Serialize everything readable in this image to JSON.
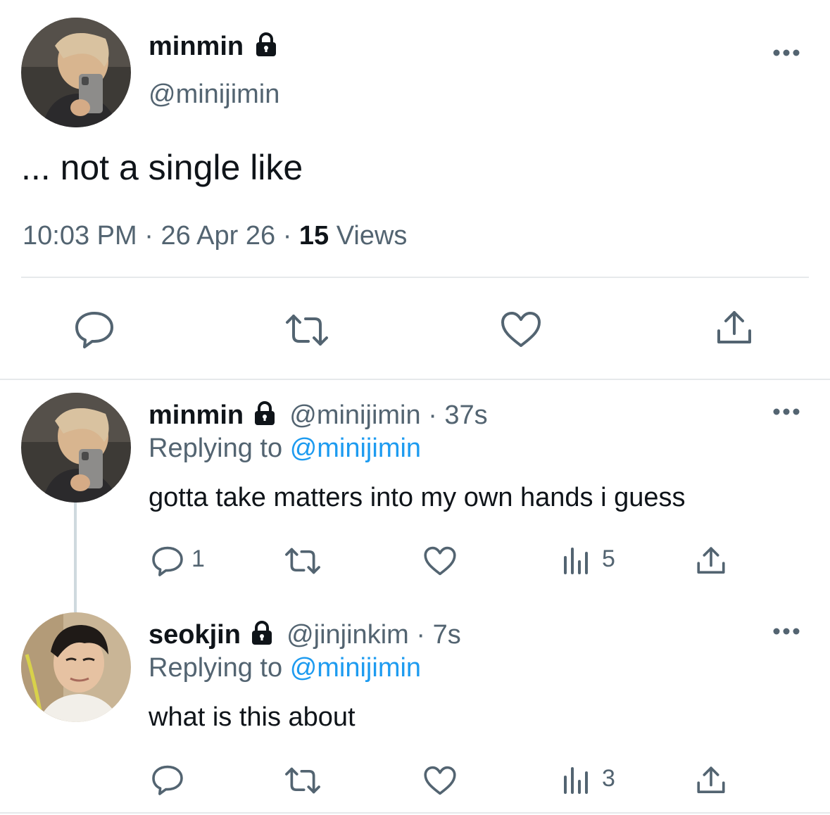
{
  "main_tweet": {
    "display_name": "minmin",
    "handle": "@minijimin",
    "text": "... not a single like",
    "time": "10:03 PM",
    "date": "26 Apr 26",
    "views_count": "15",
    "views_label": "Views",
    "sep": "·"
  },
  "replies": [
    {
      "display_name": "minmin",
      "handle": "@minijimin",
      "age": "37s",
      "replying_prefix": "Replying to",
      "replying_to": "@minijimin",
      "text": "gotta take matters into my own hands i guess",
      "reply_count": "1",
      "views_count": "5",
      "sep": "·"
    },
    {
      "display_name": "seokjin",
      "handle": "@jinjinkim",
      "age": "7s",
      "replying_prefix": "Replying to",
      "replying_to": "@minijimin",
      "text": "what is this about",
      "reply_count": "",
      "views_count": "3",
      "sep": "·"
    }
  ],
  "colors": {
    "text": "#0f1419",
    "secondary": "#536471",
    "accent": "#1d9bf0",
    "divider": "#e6e9eb"
  },
  "icons": [
    "lock-icon",
    "more-icon",
    "reply-icon",
    "retweet-icon",
    "like-icon",
    "share-icon",
    "views-icon"
  ]
}
